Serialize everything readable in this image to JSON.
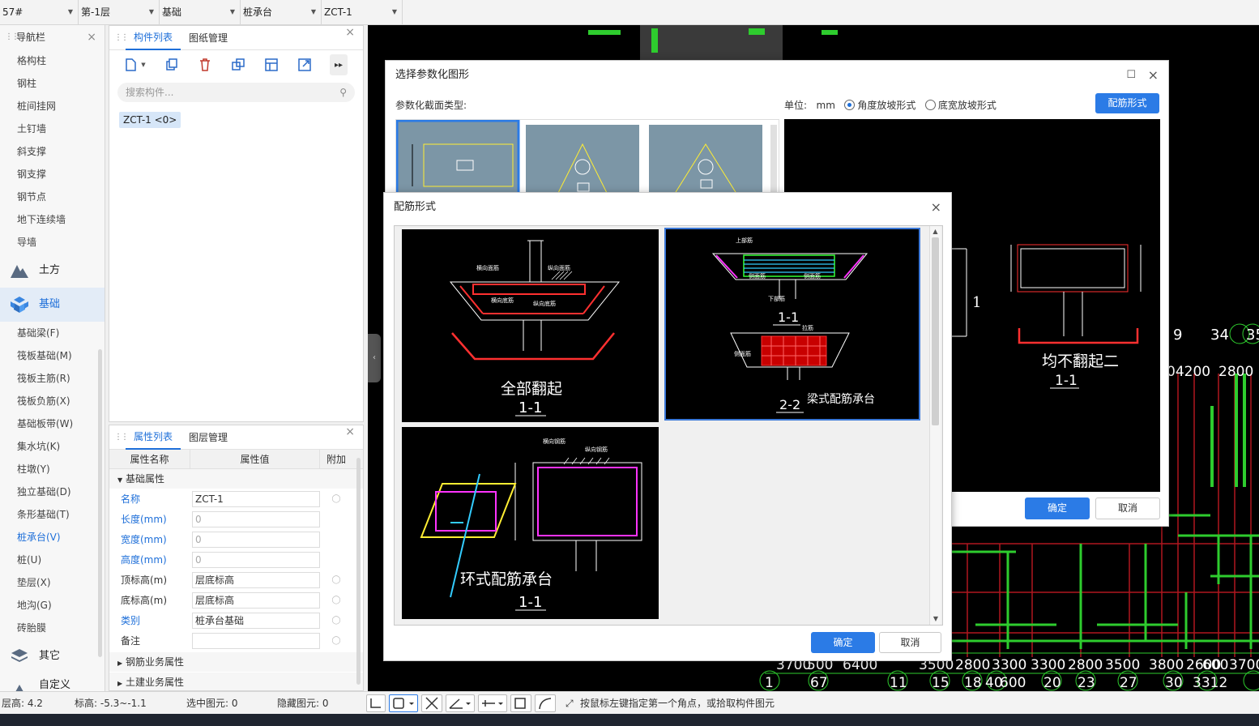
{
  "topbar": {
    "selects": [
      {
        "value": "57#",
        "w": 96
      },
      {
        "value": "第-1层",
        "w": 100
      },
      {
        "value": "基础",
        "w": 100
      },
      {
        "value": "桩承台",
        "w": 100
      },
      {
        "value": "ZCT-1",
        "w": 100
      }
    ]
  },
  "nav": {
    "title": "导航栏",
    "items_top": [
      "格构柱",
      "钢柱",
      "桩间挂网",
      "土钉墙",
      "斜支撑",
      "钢支撑",
      "钢节点",
      "地下连续墙",
      "导墙"
    ],
    "cat_earth": "土方",
    "cat_found": "基础",
    "items_found": [
      "基础梁(F)",
      "筏板基础(M)",
      "筏板主筋(R)",
      "筏板负筋(X)",
      "基础板带(W)",
      "集水坑(K)",
      "柱墩(Y)",
      "独立基础(D)",
      "条形基础(T)",
      "桩承台(V)",
      "桩(U)",
      "垫层(X)",
      "地沟(G)",
      "砖胎膜"
    ],
    "cat_other": "其它",
    "cat_custom": "自定义"
  },
  "comp": {
    "tab1": "构件列表",
    "tab2": "图纸管理",
    "search_placeholder": "搜索构件...",
    "chip": "ZCT-1 <0>"
  },
  "props": {
    "tab1": "属性列表",
    "tab2": "图层管理",
    "col_name": "属性名称",
    "col_value": "属性值",
    "col_add": "附加",
    "group1": "基础属性",
    "rows": [
      {
        "name": "名称",
        "value": "ZCT-1"
      },
      {
        "name": "长度(mm)",
        "value": "0"
      },
      {
        "name": "宽度(mm)",
        "value": "0"
      },
      {
        "name": "高度(mm)",
        "value": "0"
      },
      {
        "name": "顶标高(m)",
        "value": "层底标高"
      },
      {
        "name": "底标高(m)",
        "value": "层底标高"
      },
      {
        "name": "类别",
        "value": "桩承台基础"
      },
      {
        "name": "备注",
        "value": ""
      }
    ],
    "group2": "钢筋业务属性",
    "group3": "土建业务属性"
  },
  "status": {
    "floor_height": "层高:   4.2",
    "elev": "标高:   -5.3~-1.1",
    "selected": "选中图元:   0",
    "hidden": "隐藏图元:   0",
    "hint": "按鼠标左键指定第一个角点，或拾取构件图元"
  },
  "dlg1": {
    "title": "选择参数化图形",
    "section_label": "参数化截面类型:",
    "unit_label": "单位:",
    "unit": "mm",
    "opt1": "角度放坡形式",
    "opt2": "底宽放坡形式",
    "rebar_btn": "配筋形式",
    "ok": "确定",
    "cancel": "取消",
    "preview_caption": "均不翻起二",
    "preview_section": "1-1"
  },
  "dlg2": {
    "title": "配筋形式",
    "cap1": "全部翻起",
    "sec1": "1-1",
    "cap2": "梁式配筋承台",
    "sec2a": "1-1",
    "sec2b": "2-2",
    "cap3": "环式配筋承台",
    "sec3": "1-1",
    "ok": "确定",
    "cancel": "取消"
  },
  "canvas": {
    "nums_top": [
      "9",
      "34",
      "35"
    ],
    "dims_mid": [
      "04200",
      "2800"
    ],
    "dims_bottom": [
      "3700",
      "500",
      "6400",
      "3500",
      "2800",
      "3300",
      "3300",
      "2800",
      "3500",
      "3800",
      "2600",
      "600",
      "3700"
    ],
    "axis_bottom": [
      "1",
      "67",
      "11",
      "15",
      "18",
      "40",
      "20",
      "23",
      "27",
      "30",
      "3312"
    ],
    "axis_extra": "600"
  },
  "colors": {
    "accent": "#2b7be6",
    "cad_green": "#2ecc2e",
    "cad_red": "#ff2a2a"
  }
}
